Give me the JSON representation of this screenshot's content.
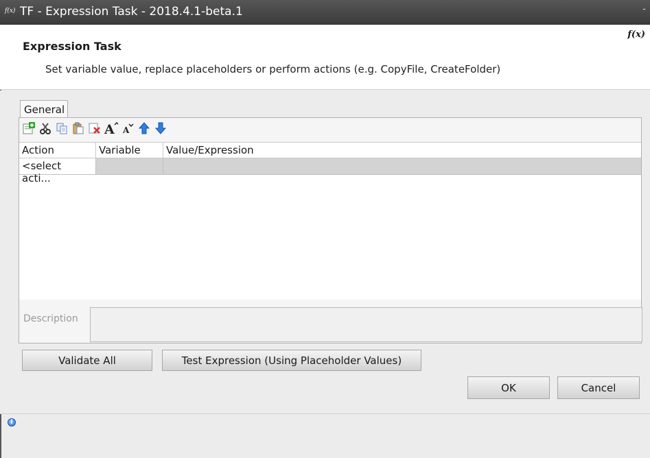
{
  "window": {
    "app_icon": "f(x)",
    "title": "TF - Expression Task - 2018.4.1-beta.1",
    "minimize": "-"
  },
  "header": {
    "title": "Expression Task",
    "description": "Set variable value, replace placeholders or perform actions (e.g. CopyFile, CreateFolder)",
    "fx_icon": "f(x)"
  },
  "tabs": [
    {
      "label": "General"
    }
  ],
  "toolbar": {
    "icons": [
      "add-row-icon",
      "cut-icon",
      "copy-icon",
      "paste-icon",
      "delete-icon",
      "increase-font-icon",
      "decrease-font-icon",
      "move-up-icon",
      "move-down-icon"
    ]
  },
  "grid": {
    "columns": [
      "Action",
      "Variable",
      "Value/Expression"
    ],
    "rows": [
      {
        "action": "<select acti...",
        "variable": "",
        "value": ""
      }
    ]
  },
  "description": {
    "label": "Description",
    "value": ""
  },
  "buttons": {
    "validate_all": "Validate All",
    "test_expression": "Test Expression (Using Placeholder Values)",
    "ok": "OK",
    "cancel": "Cancel"
  },
  "status": {
    "info_icon": "i"
  },
  "colors": {
    "titlebar": "#4a4a4a",
    "background": "#ececec",
    "selected_row": "#d3d3d3",
    "accent_blue": "#2c6fd6"
  }
}
